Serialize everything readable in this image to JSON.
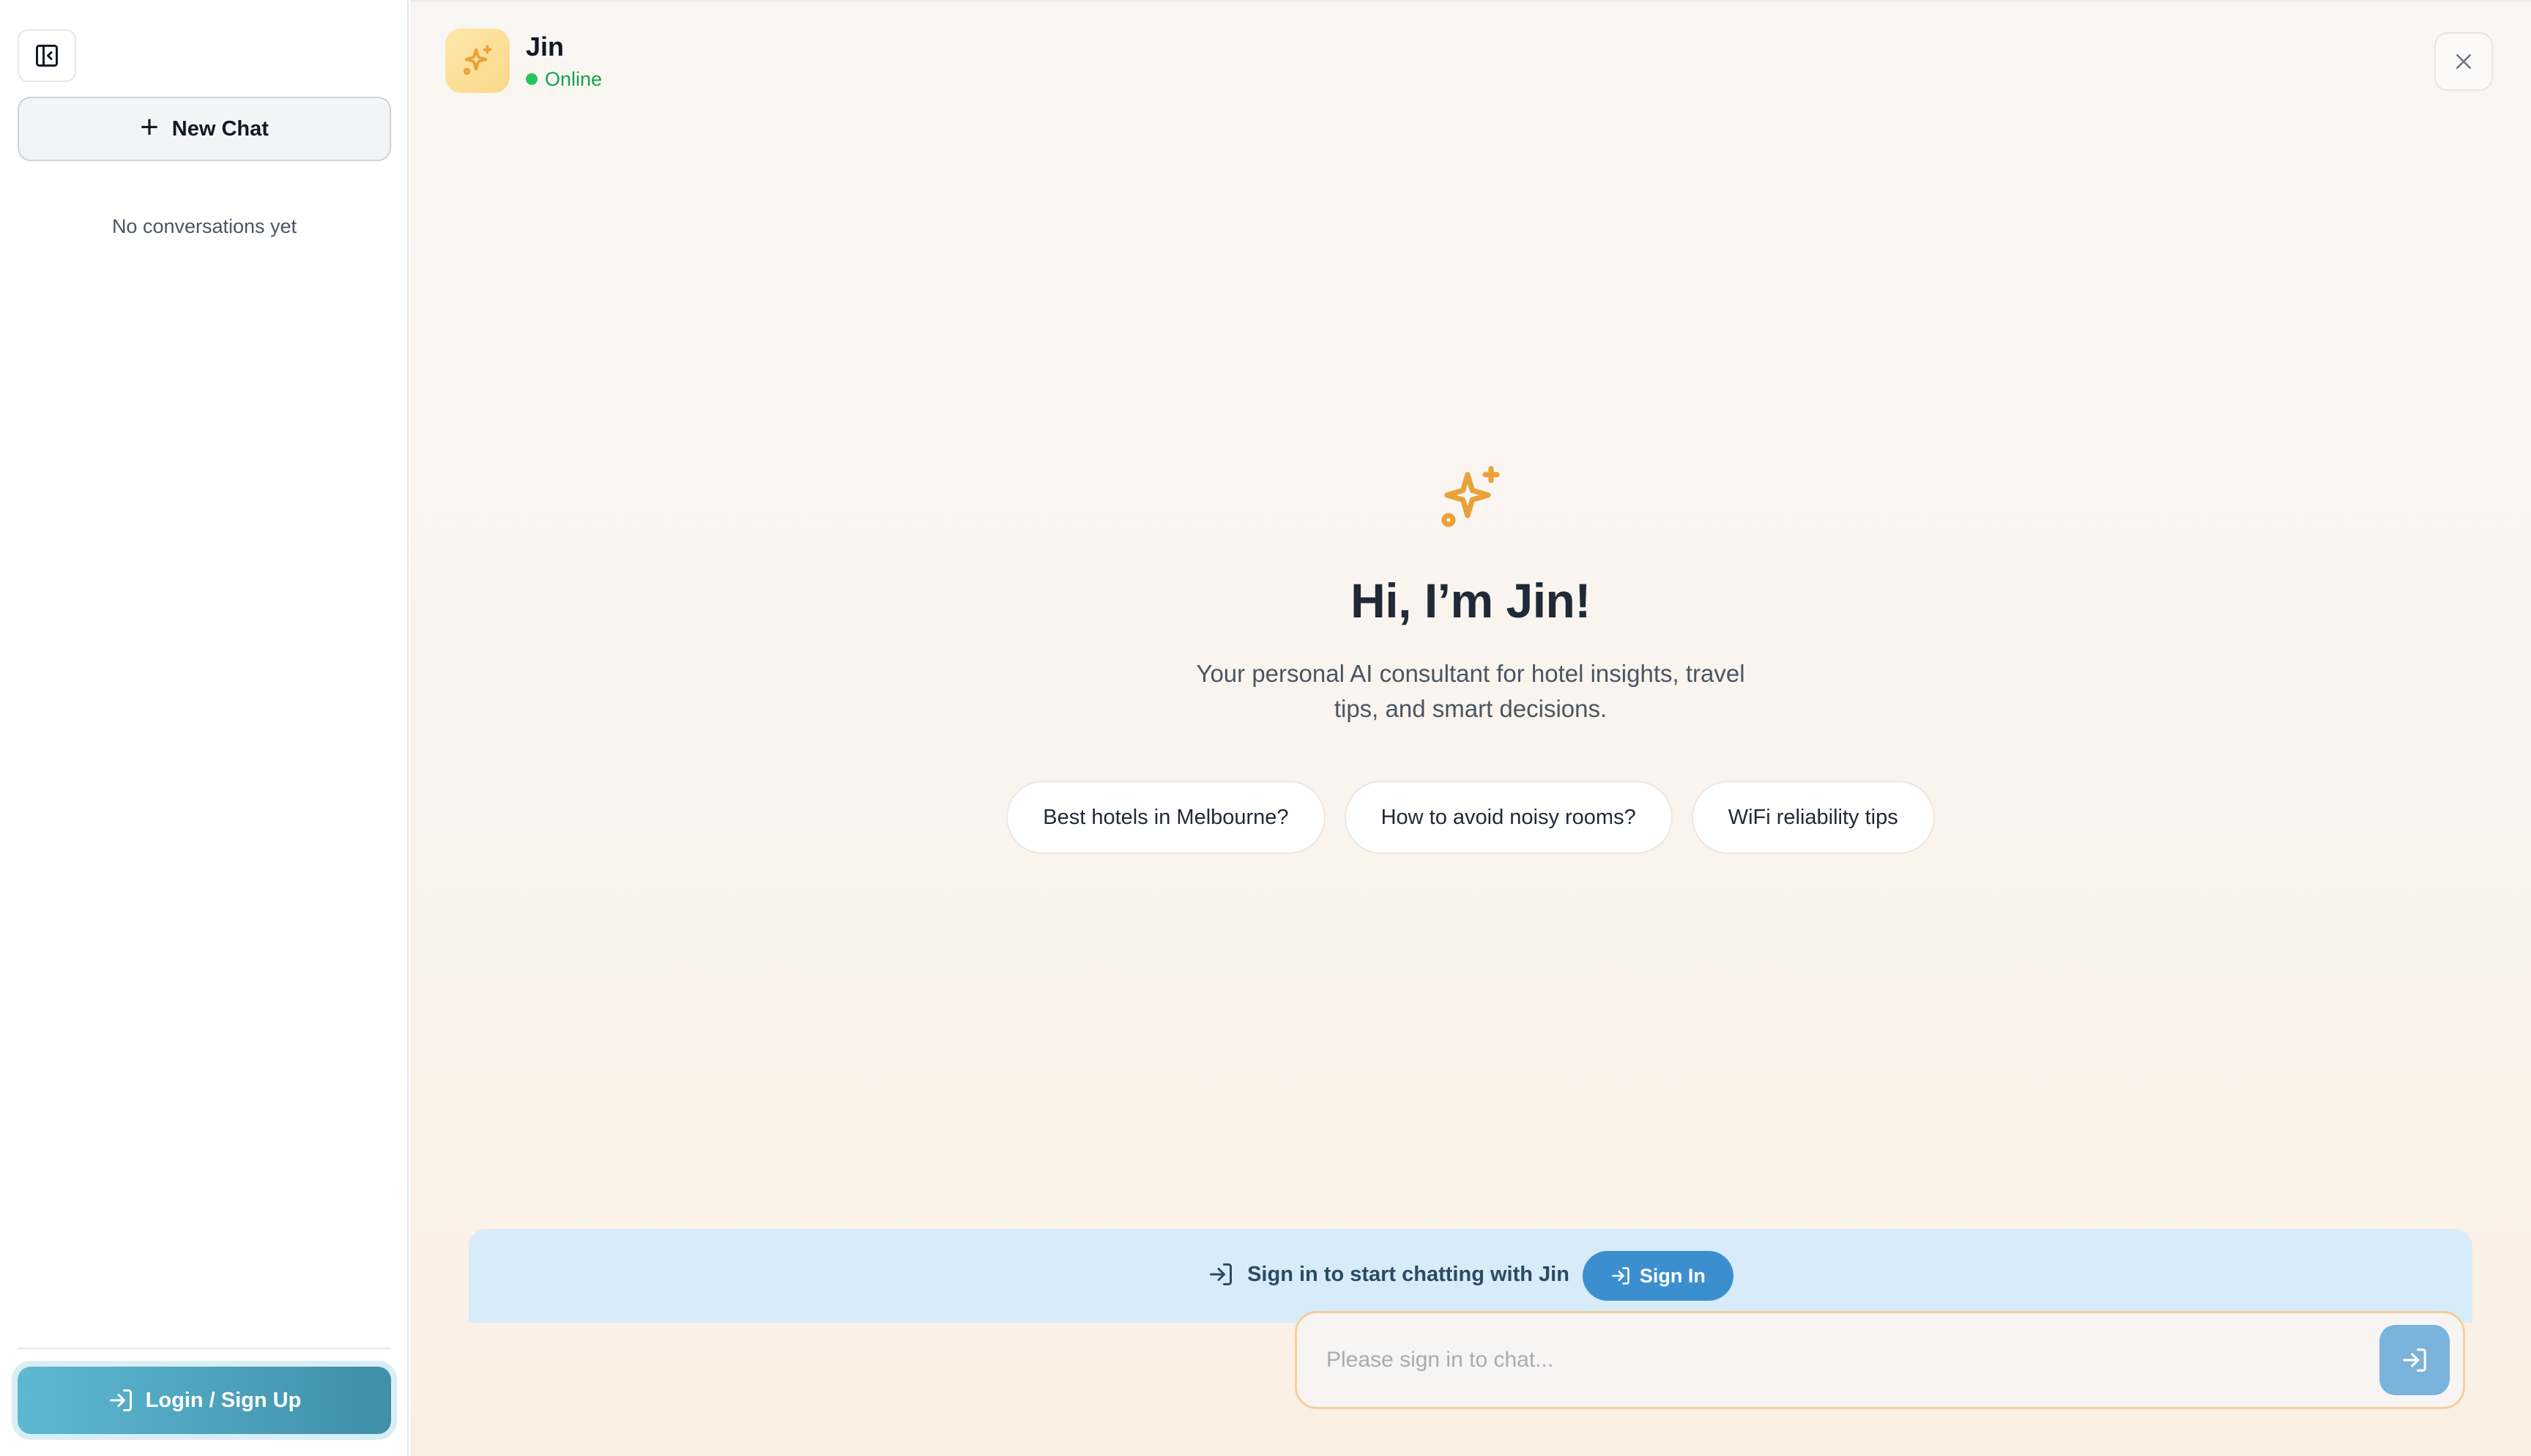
{
  "sidebar": {
    "new_chat_label": "New Chat",
    "empty_text": "No conversations yet",
    "login_label": "Login / Sign Up"
  },
  "assistant": {
    "name": "Jin",
    "status": "Online"
  },
  "hero": {
    "title": "Hi, I’m Jin!",
    "subtitle": "Your personal AI consultant for hotel insights, travel tips, and smart decisions."
  },
  "suggestions": [
    "Best hotels in Melbourne?",
    "How to avoid noisy rooms?",
    "WiFi reliability tips"
  ],
  "signin": {
    "banner_text": "Sign in to start chatting with Jin",
    "button_label": "Sign In"
  },
  "composer": {
    "placeholder": "Please sign in to chat..."
  },
  "icons": {
    "collapse": "sidebar-collapse-icon",
    "new_chat": "plus-icon",
    "login": "login-arrow-icon",
    "avatar": "sparkles-icon",
    "close": "close-icon",
    "send": "login-arrow-icon"
  },
  "colors": {
    "accent_orange": "#e8a23a",
    "online_green": "#22c55e",
    "signin_blue": "#3c8fcf",
    "login_teal": "#4fa7c1"
  }
}
